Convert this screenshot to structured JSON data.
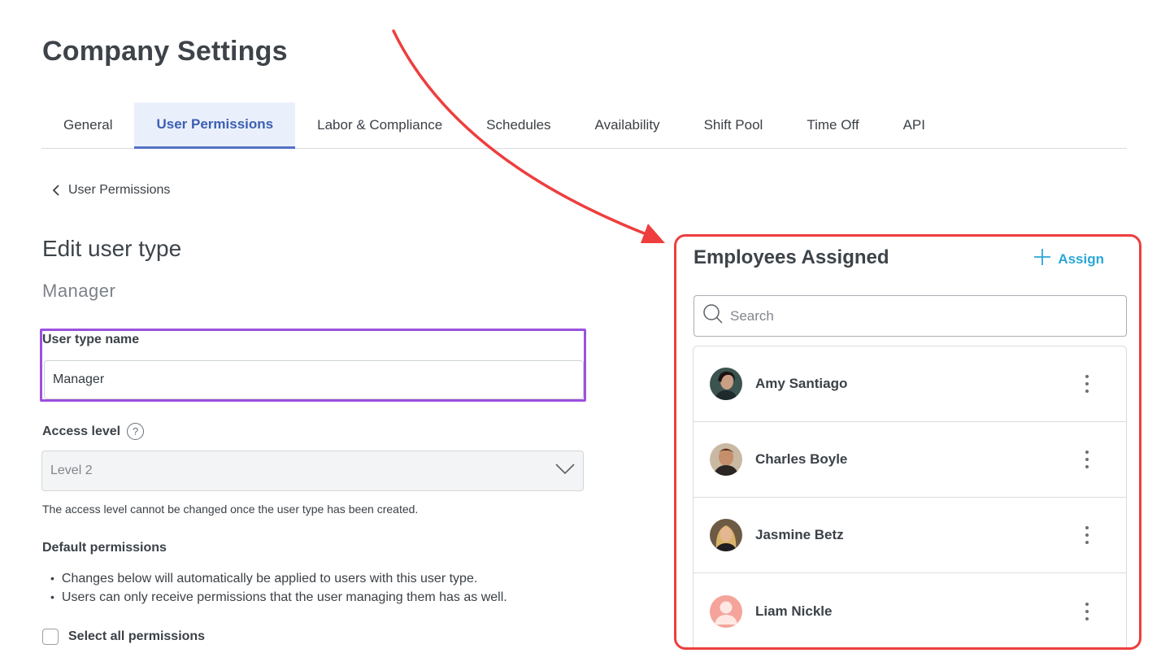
{
  "page": {
    "title": "Company Settings"
  },
  "tabs": [
    {
      "label": "General",
      "active": false
    },
    {
      "label": "User Permissions",
      "active": true
    },
    {
      "label": "Labor & Compliance",
      "active": false
    },
    {
      "label": "Schedules",
      "active": false
    },
    {
      "label": "Availability",
      "active": false
    },
    {
      "label": "Shift Pool",
      "active": false
    },
    {
      "label": "Time Off",
      "active": false
    },
    {
      "label": "API",
      "active": false
    }
  ],
  "breadcrumb": {
    "label": "User Permissions",
    "icon": "chevron-left-icon"
  },
  "edit": {
    "title": "Edit user type",
    "subtitle": "Manager",
    "name_label": "User type name",
    "name_value": "Manager",
    "access_label": "Access level",
    "access_help": "?",
    "access_value": "Level 2",
    "access_helper": "The access level cannot be changed once the user type has been created.",
    "permissions_label": "Default permissions",
    "bullets": [
      "Changes below will automatically be applied to users with this user type.",
      "Users can only receive permissions that the user managing them has as well."
    ],
    "select_all_label": "Select all permissions"
  },
  "employees": {
    "title": "Employees Assigned",
    "assign_label": "Assign",
    "search_placeholder": "Search",
    "list": [
      {
        "name": "Amy Santiago",
        "avatar": "photo"
      },
      {
        "name": "Charles Boyle",
        "avatar": "photo"
      },
      {
        "name": "Jasmine Betz",
        "avatar": "photo"
      },
      {
        "name": "Liam Nickle",
        "avatar": "placeholder"
      }
    ]
  },
  "colors": {
    "accent_tab": "#3c5fb3",
    "assign": "#2aa7d6",
    "highlight_field": "#9b51e0",
    "highlight_panel": "#ee3e3e"
  }
}
